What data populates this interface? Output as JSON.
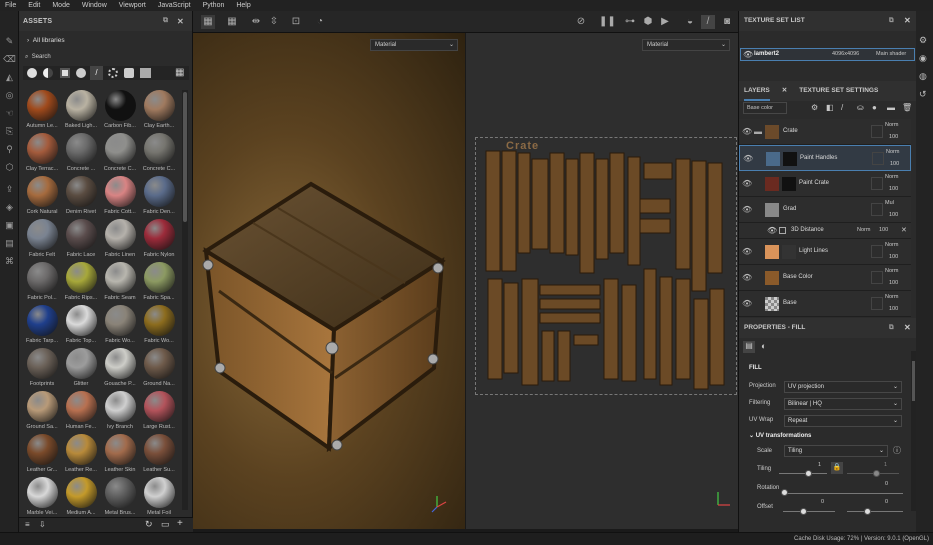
{
  "menu": [
    "File",
    "Edit",
    "Mode",
    "Window",
    "Viewport",
    "JavaScript",
    "Python",
    "Help"
  ],
  "assets": {
    "title": "ASSETS",
    "breadcrumb": "All libraries",
    "search_placeholder": "Search",
    "materials": [
      {
        "label": "Autumn Le...",
        "color": "#a04a1c"
      },
      {
        "label": "Baked Ligh...",
        "color": "#b9b2a2"
      },
      {
        "label": "Carbon Fib...",
        "color": "#111111"
      },
      {
        "label": "Clay Earth...",
        "color": "#a07a5f"
      },
      {
        "label": "Clay Terrac...",
        "color": "#a45b3c"
      },
      {
        "label": "Concrete ...",
        "color": "#6a6a6a"
      },
      {
        "label": "Concrete C...",
        "color": "#8f8f8c"
      },
      {
        "label": "Concrete C...",
        "color": "#76756f"
      },
      {
        "label": "Cork Natural",
        "color": "#a66b3e"
      },
      {
        "label": "Denim Rivet",
        "color": "#5a4c41"
      },
      {
        "label": "Fabric Cott...",
        "color": "#d98484"
      },
      {
        "label": "Fabric Den...",
        "color": "#5a6b8a"
      },
      {
        "label": "Fabric Felt",
        "color": "#7a8391"
      },
      {
        "label": "Fabric Lace",
        "color": "#5a4c4c"
      },
      {
        "label": "Fabric Linen",
        "color": "#b5b1ab"
      },
      {
        "label": "Fabric Nylon",
        "color": "#9c2b3a"
      },
      {
        "label": "Fabric Pol...",
        "color": "#6c6a6a"
      },
      {
        "label": "Fabric Rips...",
        "color": "#a7a83a"
      },
      {
        "label": "Fabric Seam",
        "color": "#b8b6ae"
      },
      {
        "label": "Fabric Spa...",
        "color": "#8c9a62"
      },
      {
        "label": "Fabric Tarp...",
        "color": "#1f3f8c"
      },
      {
        "label": "Fabric Top...",
        "color": "#dadada"
      },
      {
        "label": "Fabric Wo...",
        "color": "#8a8378"
      },
      {
        "label": "Fabric Wo...",
        "color": "#8c6c1e"
      },
      {
        "label": "Footprints",
        "color": "#6b6158"
      },
      {
        "label": "Glitter",
        "color": "#9c9c9c"
      },
      {
        "label": "Gouache P...",
        "color": "#cdcdc8"
      },
      {
        "label": "Ground Na...",
        "color": "#6e5a4a"
      },
      {
        "label": "Ground Sa...",
        "color": "#b89a78"
      },
      {
        "label": "Human Fe...",
        "color": "#b87050"
      },
      {
        "label": "Ivy Branch",
        "color": "#cfcfcf"
      },
      {
        "label": "Large Rust...",
        "color": "#b3535b"
      },
      {
        "label": "Leather Gr...",
        "color": "#7a4a2a"
      },
      {
        "label": "Leather Re...",
        "color": "#b88a3a"
      },
      {
        "label": "Leather Skin",
        "color": "#a26b4c"
      },
      {
        "label": "Leather Su...",
        "color": "#7a4f3a"
      },
      {
        "label": "Marble Vei...",
        "color": "#d8d8d8"
      },
      {
        "label": "Medium A...",
        "color": "#c49a2a"
      },
      {
        "label": "Metal Brus...",
        "color": "#606060"
      },
      {
        "label": "Metal Foil",
        "color": "#d0d0d0"
      }
    ]
  },
  "viewport": {
    "view3d_mode": "Material",
    "view2d_mode": "Material",
    "uv_title": "Crate"
  },
  "texture_set_list": {
    "title": "TEXTURE SET LIST",
    "name": "lambert2",
    "resolution": "4096x4096",
    "shader": "Main shader"
  },
  "layers": {
    "tab1": "LAYERS",
    "tab2": "TEXTURE SET SETTINGS",
    "channel": "Base color",
    "items": [
      {
        "name": "Crate",
        "blend": "Norm",
        "opacity": "100",
        "color": "#6b4a2a",
        "selected": false
      },
      {
        "name": "Paint Handles",
        "blend": "Norm",
        "opacity": "100",
        "color": "#4a6a8a",
        "selected": true
      },
      {
        "name": "Paint Crate",
        "blend": "Norm",
        "opacity": "100",
        "color": "#6a2a20",
        "selected": false
      },
      {
        "name": "Grad",
        "blend": "Mul",
        "opacity": "100",
        "color": "#888888",
        "selected": false
      },
      {
        "name": "3D Distance",
        "blend": "Norm",
        "opacity": "100",
        "color": "#aaaaaa",
        "selected": false
      },
      {
        "name": "Light Lines",
        "blend": "Norm",
        "opacity": "100",
        "color": "#d9935a",
        "selected": false
      },
      {
        "name": "Base Color",
        "blend": "Norm",
        "opacity": "100",
        "color": "#8a5a2a",
        "selected": false
      },
      {
        "name": "Base",
        "blend": "Norm",
        "opacity": "100",
        "color": "#bbbbbb",
        "selected": false
      }
    ]
  },
  "properties": {
    "title": "PROPERTIES - FILL",
    "section": "FILL",
    "projection_label": "Projection",
    "projection": "UV projection",
    "filtering_label": "Filtering",
    "filtering": "Bilinear | HQ",
    "uvwrap_label": "UV Wrap",
    "uvwrap": "Repeat",
    "uv_transform": "UV transformations",
    "scale_label": "Scale",
    "scale": "Tiling",
    "tiling_label": "Tiling",
    "tiling_value": "1",
    "tiling_value2": "1",
    "rotation_label": "Rotation",
    "rotation_value": "0",
    "offset_label": "Offset",
    "offset_x": "0",
    "offset_y": "0"
  },
  "status": "Cache Disk Usage:    72%  |  Version: 9.0.1 (OpenGL)"
}
